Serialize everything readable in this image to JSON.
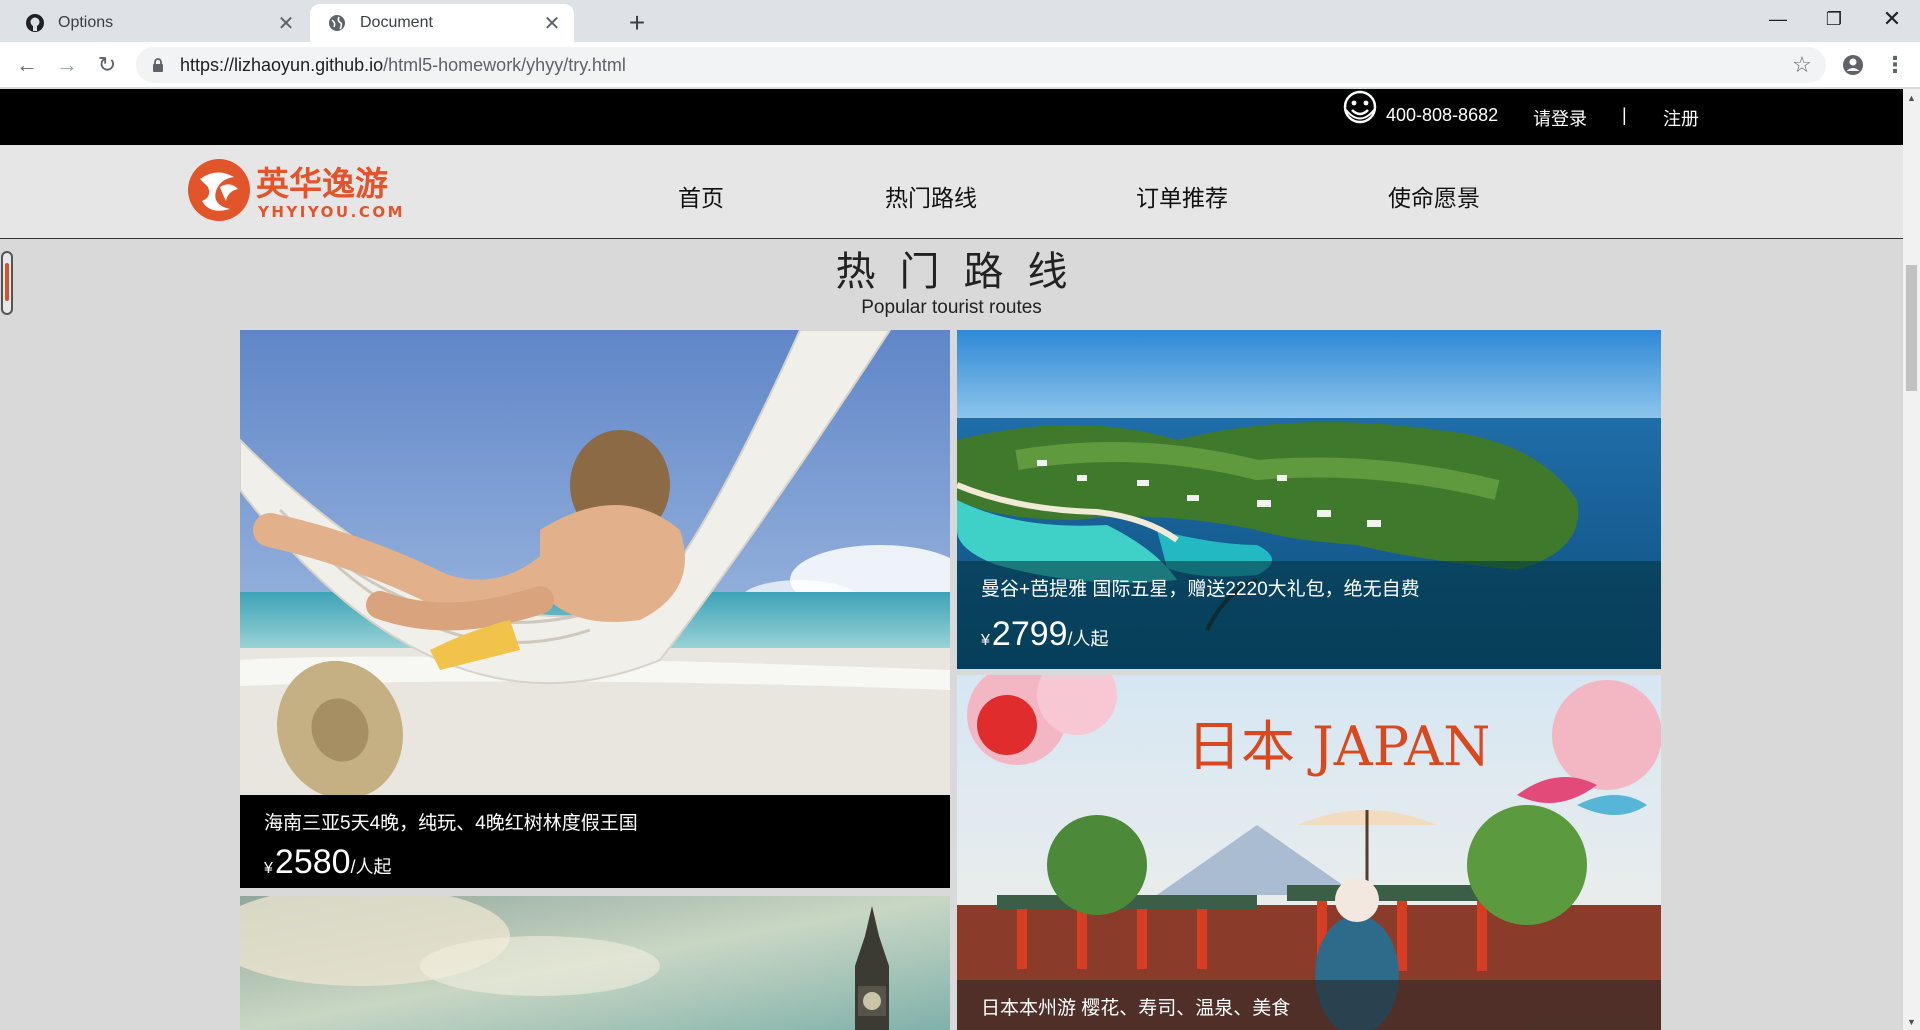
{
  "browser": {
    "tabs": [
      {
        "title": "Options",
        "icon": "github-icon",
        "active": false
      },
      {
        "title": "Document",
        "icon": "globe-icon",
        "active": true
      }
    ],
    "url_host": "https://lizhaoyun.github.io",
    "url_path": "/html5-homework/yhyy/try.html"
  },
  "topbar": {
    "phone": "400-808-8682",
    "login": "请登录",
    "separator": "|",
    "register": "注册"
  },
  "header": {
    "logo_cn": "英华逸游",
    "logo_en": "YHYIYOU.COM",
    "nav": [
      "首页",
      "热门路线",
      "订单推荐",
      "使命愿景"
    ]
  },
  "section": {
    "title": "热门路线",
    "subtitle": "Popular tourist routes"
  },
  "routes": [
    {
      "title": "海南三亚5天4晚，纯玩、4晚红树林度假王国",
      "currency": "¥",
      "price": "2580",
      "unit": "/人起"
    },
    {
      "title": "曼谷+芭提雅 国际五星，赠送2220大礼包，绝无自费",
      "currency": "¥",
      "price": "2799",
      "unit": "/人起"
    },
    {
      "title": "日本本州游 樱花、寿司、温泉、美食",
      "image_text": "日本 JAPAN"
    }
  ],
  "colors": {
    "brand": "#e2542a",
    "topbar": "#000000",
    "page_bg": "#d9d9d9"
  }
}
